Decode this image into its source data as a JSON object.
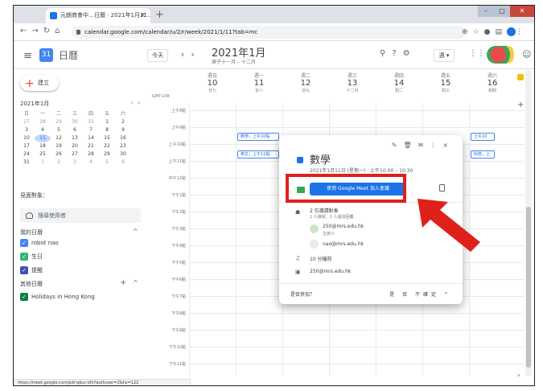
{
  "browser": {
    "tab_title": "元朗商會中…日曆 · 2021年1月11…",
    "tab_close": "×",
    "new_tab": "+",
    "url": "calendar.google.com/calendar/u/2/r/week/2021/1/11?tab=mc",
    "status_url": "https://meet.google.com/pdr-qkuc-idh?authuser=2&hs=122"
  },
  "header": {
    "app_title": "日曆",
    "today_label": "今天",
    "prev": "‹",
    "next": "›",
    "month_title": "2021年1月",
    "lunar_subtitle": "庚子十一月 – 十二月",
    "view_label": "週 ▾"
  },
  "sidebar": {
    "create_label": "建立",
    "mini_month": "2021年1月",
    "weekdays": [
      "日",
      "一",
      "二",
      "三",
      "四",
      "五",
      "六"
    ],
    "weeks": [
      [
        "27",
        "28",
        "29",
        "30",
        "31",
        "1",
        "2"
      ],
      [
        "3",
        "4",
        "5",
        "6",
        "7",
        "8",
        "9"
      ],
      [
        "10",
        "11",
        "12",
        "13",
        "14",
        "15",
        "16"
      ],
      [
        "17",
        "18",
        "19",
        "20",
        "21",
        "22",
        "23"
      ],
      [
        "24",
        "25",
        "26",
        "27",
        "28",
        "29",
        "30"
      ],
      [
        "31",
        "1",
        "2",
        "3",
        "4",
        "5",
        "6"
      ]
    ],
    "meet_with": "見面對象：",
    "search_people": "搜尋使用者",
    "my_calendars": "我的日曆",
    "my_calendar_items": [
      {
        "label": "robot nao",
        "color": "#4285f4"
      },
      {
        "label": "生日",
        "color": "#33b679"
      },
      {
        "label": "提醒",
        "color": "#3f51b5"
      }
    ],
    "other_calendars": "其他日曆",
    "other_calendar_items": [
      {
        "label": "Holidays in Hong Kong",
        "color": "#0b8043"
      }
    ]
  },
  "week": {
    "timezone": "GMT+08",
    "days": [
      {
        "name": "週日",
        "date": "10",
        "lunar": "廿七"
      },
      {
        "name": "週一",
        "date": "11",
        "lunar": "廿八"
      },
      {
        "name": "週二",
        "date": "12",
        "lunar": "廿九"
      },
      {
        "name": "週三",
        "date": "13",
        "lunar": "十二月"
      },
      {
        "name": "週四",
        "date": "14",
        "lunar": "初二"
      },
      {
        "name": "週五",
        "date": "15",
        "lunar": "初三"
      },
      {
        "name": "週六",
        "date": "16",
        "lunar": "初四"
      }
    ],
    "hours": [
      "上午8點",
      "上午9點",
      "上午10點",
      "上午11點",
      "中午12點",
      "下午1點",
      "下午2點",
      "下午3點",
      "下午4點",
      "下午5點",
      "下午6點",
      "下午7點",
      "下午8點",
      "下午9點",
      "下午10點",
      "下午11點"
    ],
    "events": [
      {
        "label": "數學，上午10點"
      },
      {
        "label": "英文，上午11點"
      },
      {
        "label": "上午10"
      },
      {
        "label": "科技，上"
      }
    ]
  },
  "popup": {
    "title": "數學",
    "datetime": "2021年1月11日 (星期一) · 上午10:00 – 10:30",
    "meet_button": "使用 Google Meet 加入會議",
    "guests_count": "2 位邀請對象",
    "guests_summary": "1 人接受，1 人還沒回覆",
    "guest1": "250@mrs.edu.hk",
    "guest1_role": "主辦人",
    "guest2": "nao@mrs.edu.hk",
    "reminder": "10 分鐘前",
    "calendar_owner": "250@mrs.edu.hk",
    "rsvp_question": "是否參加？",
    "rsvp_yes": "是",
    "rsvp_no": "否",
    "rsvp_maybe": "不確定"
  }
}
